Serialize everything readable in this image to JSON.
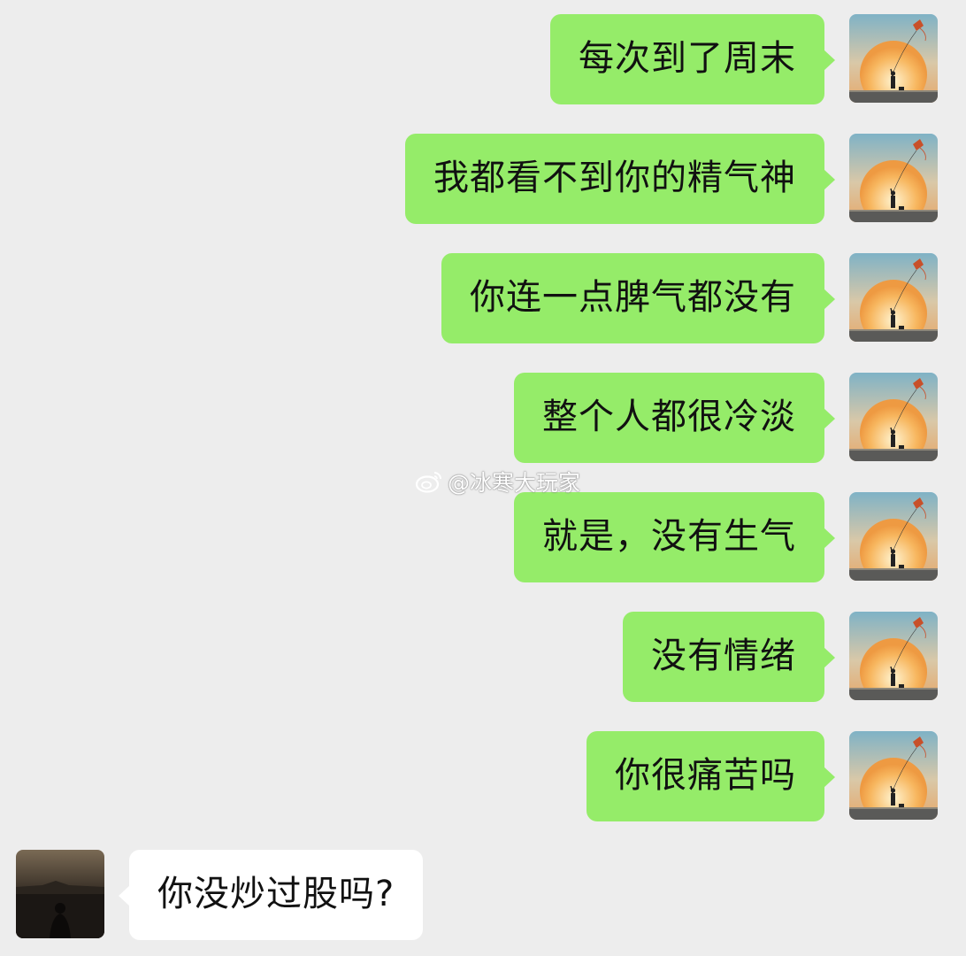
{
  "chat": {
    "outgoing": [
      {
        "text": "每次到了周末"
      },
      {
        "text": "我都看不到你的精气神"
      },
      {
        "text": "你连一点脾气都没有"
      },
      {
        "text": "整个人都很冷淡"
      },
      {
        "text": "就是，没有生气"
      },
      {
        "text": "没有情绪"
      },
      {
        "text": "你很痛苦吗"
      }
    ],
    "incoming": [
      {
        "text": "你没炒过股吗?"
      }
    ]
  },
  "watermark": {
    "text": "@冰寒大玩家",
    "icon": "weibo-logo-icon"
  },
  "colors": {
    "background": "#ededed",
    "outgoing_bubble": "#95ec69",
    "incoming_bubble": "#ffffff"
  }
}
